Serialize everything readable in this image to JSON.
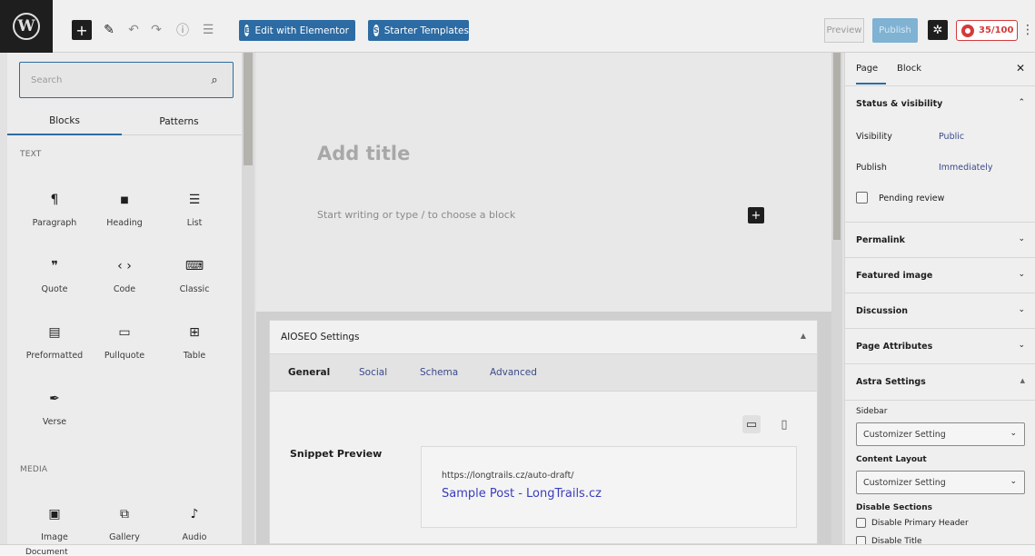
{
  "toolbar": {
    "logo_icon": "wordpress-logo",
    "elementor_label": "Edit with Elementor",
    "starter_label": "Starter Templates",
    "preview_label": "Preview",
    "publish_label": "Publish",
    "aioseo_score": "35/100"
  },
  "inserter": {
    "search_placeholder": "Search",
    "tabs": [
      "Blocks",
      "Patterns"
    ],
    "text_heading": "TEXT",
    "media_heading": "MEDIA",
    "text_blocks": [
      {
        "label": "Paragraph",
        "icon": "¶"
      },
      {
        "label": "Heading",
        "icon": "■"
      },
      {
        "label": "List",
        "icon": "☰"
      },
      {
        "label": "Quote",
        "icon": "❞"
      },
      {
        "label": "Code",
        "icon": "‹ ›"
      },
      {
        "label": "Classic",
        "icon": "⌨"
      },
      {
        "label": "Preformatted",
        "icon": "▤"
      },
      {
        "label": "Pullquote",
        "icon": "▭"
      },
      {
        "label": "Table",
        "icon": "⊞"
      },
      {
        "label": "Verse",
        "icon": "✒"
      }
    ],
    "media_blocks": [
      {
        "label": "Image",
        "icon": "▣"
      },
      {
        "label": "Gallery",
        "icon": "⧉"
      },
      {
        "label": "Audio",
        "icon": "♪"
      }
    ]
  },
  "editor": {
    "title_placeholder": "Add title",
    "paragraph_placeholder": "Start writing or type / to choose a block"
  },
  "aioseo": {
    "panel_title": "AIOSEO Settings",
    "tabs": [
      "General",
      "Social",
      "Schema",
      "Advanced"
    ],
    "snippet_label": "Snippet Preview",
    "snippet_url": "https://longtrails.cz/auto-draft/",
    "snippet_title": "Sample Post - LongTrails.cz"
  },
  "sidebar": {
    "tab_page": "Page",
    "tab_block": "Block",
    "status_title": "Status & visibility",
    "visibility_label": "Visibility",
    "visibility_value": "Public",
    "publish_label": "Publish",
    "publish_value": "Immediately",
    "pending_label": "Pending review",
    "permalink": "Permalink",
    "featured_image": "Featured image",
    "discussion": "Discussion",
    "page_attributes": "Page Attributes",
    "astra_title": "Astra Settings",
    "sidebar_label": "Sidebar",
    "sidebar_value": "Customizer Setting",
    "content_layout_label": "Content Layout",
    "content_layout_value": "Customizer Setting",
    "disable_sections_label": "Disable Sections",
    "disable_primary_header": "Disable Primary Header",
    "disable_title": "Disable Title"
  },
  "footer": {
    "breadcrumb": "Document"
  },
  "colors": {
    "accent": "#2c6ba3",
    "aioseo_red": "#d43a3a",
    "link": "#3a3dbd"
  }
}
